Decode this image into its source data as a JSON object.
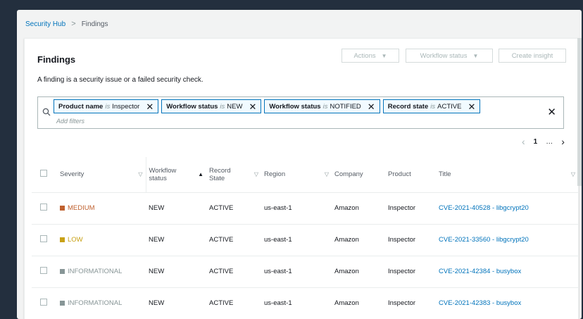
{
  "breadcrumb": {
    "root": "Security Hub",
    "separator": ">",
    "current": "Findings"
  },
  "header": {
    "title": "Findings",
    "description": "A finding is a security issue or a failed security check."
  },
  "actions": {
    "actions_label": "Actions",
    "workflow_label": "Workflow status",
    "create_label": "Create insight"
  },
  "filters": {
    "tokens": [
      {
        "key": "Product name",
        "op": "is",
        "value": "Inspector"
      },
      {
        "key": "Workflow status",
        "op": "is",
        "value": "NEW"
      },
      {
        "key": "Workflow status",
        "op": "is",
        "value": "NOTIFIED"
      },
      {
        "key": "Record state",
        "op": "is",
        "value": "ACTIVE"
      }
    ],
    "placeholder": "Add filters"
  },
  "pagination": {
    "prev": "‹",
    "page": "1",
    "ellipsis": "…",
    "next": "›"
  },
  "table": {
    "columns": {
      "severity": "Severity",
      "workflow_line1": "Workflow",
      "workflow_line2": "status",
      "record_line1": "Record",
      "record_line2": "State",
      "region": "Region",
      "company": "Company",
      "product": "Product",
      "title": "Title"
    },
    "rows": [
      {
        "severity": "MEDIUM",
        "severity_color": "#c0612f",
        "workflow": "NEW",
        "record": "ACTIVE",
        "region": "us-east-1",
        "company": "Amazon",
        "product": "Inspector",
        "title": "CVE-2021-40528 - libgcrypt20"
      },
      {
        "severity": "LOW",
        "severity_color": "#c8a116",
        "workflow": "NEW",
        "record": "ACTIVE",
        "region": "us-east-1",
        "company": "Amazon",
        "product": "Inspector",
        "title": "CVE-2021-33560 - libgcrypt20"
      },
      {
        "severity": "INFORMATIONAL",
        "severity_color": "#879596",
        "workflow": "NEW",
        "record": "ACTIVE",
        "region": "us-east-1",
        "company": "Amazon",
        "product": "Inspector",
        "title": "CVE-2021-42384 - busybox"
      },
      {
        "severity": "INFORMATIONAL",
        "severity_color": "#879596",
        "workflow": "NEW",
        "record": "ACTIVE",
        "region": "us-east-1",
        "company": "Amazon",
        "product": "Inspector",
        "title": "CVE-2021-42383 - busybox"
      }
    ]
  },
  "colors": {
    "link": "#0073bb",
    "background": "#232f3e",
    "panel": "#ffffff"
  }
}
